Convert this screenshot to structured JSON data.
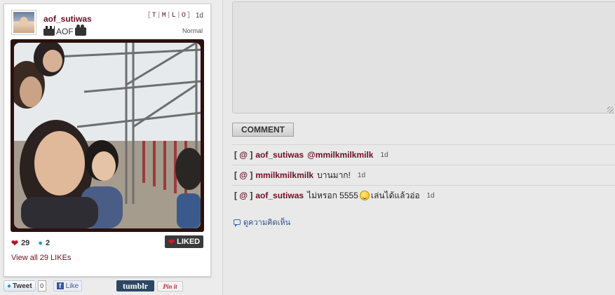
{
  "post": {
    "username": "aof_sutiwas",
    "caption": "AOF",
    "filters": [
      "T",
      "M",
      "L",
      "O"
    ],
    "time": "1d",
    "filter_name": "Normal",
    "like_count": "29",
    "comment_count": "2",
    "liked_label": "LIKED",
    "view_all_label": "View all 29 LIKEs"
  },
  "share": {
    "tweet_label": "Tweet",
    "tweet_count": "0",
    "facebook_label": "Like",
    "tumblr_label": "tumblr",
    "pinterest_label": "Pin it"
  },
  "comment_form": {
    "button_label": "COMMENT"
  },
  "comments": [
    {
      "user": "aof_sutiwas",
      "text_before": "",
      "mention": "@mmilkmilkmilk",
      "text_after": "",
      "emoji": false,
      "time": "1d"
    },
    {
      "user": "mmilkmilkmilk",
      "text_before": "บานมาก!",
      "mention": "",
      "text_after": "",
      "emoji": false,
      "time": "1d"
    },
    {
      "user": "aof_sutiwas",
      "text_before": "ไม่หรอก 5555",
      "mention": "",
      "text_after": "เล่นได้แล้วอ่อ",
      "emoji": true,
      "time": "1d"
    }
  ],
  "all_comments_label": "ดูความคิดเห็น",
  "colors": {
    "username": "#6b0f24",
    "heart": "#b5122a",
    "comment_bubble": "#1aa0a8",
    "liked_button": "#3a3a3a",
    "tumblr": "#2c4762",
    "link": "#2a4f8a"
  },
  "icons": {
    "heart": "heart-icon",
    "comment": "speech-bubble-icon",
    "twitter": "twitter-bird-icon",
    "facebook": "facebook-icon",
    "all_comments": "comment-icon"
  }
}
